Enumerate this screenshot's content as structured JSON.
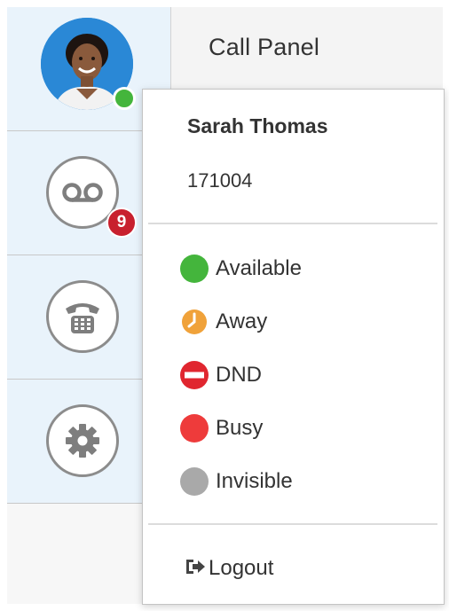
{
  "header": {
    "title": "Call Panel"
  },
  "user": {
    "name": "Sarah Thomas",
    "extension": "171004",
    "presence_color": "#44b53c"
  },
  "voicemail": {
    "unread_count": "9"
  },
  "statuses": [
    {
      "label": "Available",
      "icon": "available-dot-icon",
      "color": "#44b53c"
    },
    {
      "label": "Away",
      "icon": "away-clock-icon",
      "color": "#f0a23a"
    },
    {
      "label": "DND",
      "icon": "dnd-icon",
      "color": "#e0262f"
    },
    {
      "label": "Busy",
      "icon": "busy-dot-icon",
      "color": "#ee3b3b"
    },
    {
      "label": "Invisible",
      "icon": "invisible-dot-icon",
      "color": "#a9a9a9"
    }
  ],
  "menu": {
    "logout_label": "Logout",
    "logout_icon": "logout-icon"
  },
  "sidebar": {
    "items": [
      {
        "icon": "user-avatar"
      },
      {
        "icon": "voicemail-icon"
      },
      {
        "icon": "dialpad-phone-icon"
      },
      {
        "icon": "gear-icon"
      }
    ]
  }
}
